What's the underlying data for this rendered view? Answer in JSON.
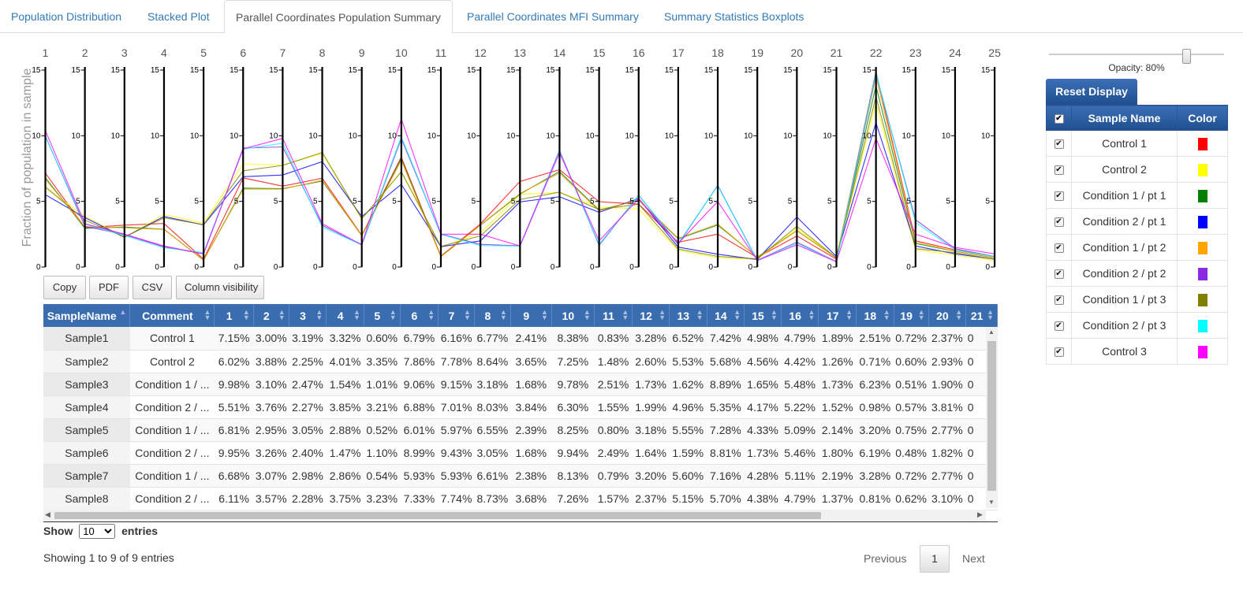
{
  "tabs": [
    {
      "label": "Population Distribution",
      "active": false
    },
    {
      "label": "Stacked Plot",
      "active": false
    },
    {
      "label": "Parallel Coordinates Population Summary",
      "active": true
    },
    {
      "label": "Parallel Coordinates MFI Summary",
      "active": false
    },
    {
      "label": "Summary Statistics Boxplots",
      "active": false
    }
  ],
  "chart_data": {
    "type": "line",
    "ylabel": "Fraction of population in sample",
    "axes": [
      "1",
      "2",
      "3",
      "4",
      "5",
      "6",
      "7",
      "8",
      "9",
      "10",
      "11",
      "12",
      "13",
      "14",
      "15",
      "16",
      "17",
      "18",
      "19",
      "20",
      "21",
      "22",
      "23",
      "24",
      "25"
    ],
    "ylim": [
      0,
      15
    ],
    "yticks": [
      0,
      5,
      10,
      15
    ],
    "series": [
      {
        "name": "Control 1",
        "color": "#ff0000",
        "values": [
          7.15,
          3.0,
          3.19,
          3.32,
          0.6,
          6.79,
          6.16,
          6.77,
          2.41,
          8.38,
          0.83,
          3.28,
          6.52,
          7.42,
          4.98,
          4.79,
          1.89,
          2.51,
          0.72,
          2.37,
          0.6,
          14.9,
          2.0,
          1.3,
          0.8
        ]
      },
      {
        "name": "Control 2",
        "color": "#ffff00",
        "values": [
          6.02,
          3.88,
          2.25,
          4.01,
          3.35,
          7.86,
          7.78,
          8.64,
          3.65,
          7.25,
          1.48,
          2.6,
          5.53,
          5.68,
          4.56,
          4.42,
          1.26,
          0.71,
          0.6,
          2.93,
          0.7,
          12.5,
          1.3,
          0.9,
          0.5
        ]
      },
      {
        "name": "Condition 1 / pt 1",
        "color": "#008000",
        "values": [
          6.81,
          2.95,
          3.05,
          2.88,
          0.52,
          6.01,
          5.97,
          6.55,
          2.39,
          8.25,
          0.8,
          3.18,
          5.55,
          7.28,
          4.33,
          5.09,
          2.14,
          3.2,
          0.75,
          2.77,
          0.7,
          13.8,
          1.8,
          1.2,
          0.7
        ]
      },
      {
        "name": "Condition 2 / pt 1",
        "color": "#0000ff",
        "values": [
          5.51,
          3.76,
          2.27,
          3.85,
          3.21,
          6.88,
          7.01,
          8.03,
          3.84,
          6.3,
          1.55,
          1.99,
          4.96,
          5.35,
          4.17,
          5.22,
          1.52,
          0.98,
          0.57,
          3.81,
          0.8,
          11.0,
          1.6,
          1.0,
          0.6
        ]
      },
      {
        "name": "Condition 1 / pt 2",
        "color": "#ffa500",
        "values": [
          6.68,
          3.07,
          2.98,
          2.86,
          0.54,
          5.93,
          5.93,
          6.61,
          2.38,
          8.13,
          0.79,
          3.2,
          5.6,
          7.16,
          4.28,
          5.11,
          2.19,
          3.28,
          0.72,
          2.77,
          0.7,
          14.5,
          1.9,
          1.2,
          0.7
        ]
      },
      {
        "name": "Condition 2 / pt 2",
        "color": "#8a2be2",
        "values": [
          9.98,
          3.1,
          2.47,
          1.54,
          1.01,
          9.06,
          9.15,
          3.18,
          1.68,
          9.78,
          2.51,
          1.73,
          1.62,
          8.89,
          1.65,
          5.48,
          1.73,
          6.23,
          0.51,
          1.9,
          0.4,
          14.7,
          3.6,
          1.4,
          0.8
        ]
      },
      {
        "name": "Condition 1 / pt 3",
        "color": "#808000",
        "values": [
          6.11,
          3.57,
          2.28,
          3.75,
          3.23,
          7.33,
          7.74,
          8.73,
          3.68,
          7.26,
          1.57,
          2.37,
          5.15,
          5.7,
          4.38,
          4.79,
          1.37,
          0.81,
          0.62,
          3.1,
          0.7,
          13.0,
          1.4,
          1.1,
          0.6
        ]
      },
      {
        "name": "Condition 2 / pt 3",
        "color": "#00ffff",
        "values": [
          9.95,
          3.26,
          2.4,
          1.47,
          1.1,
          8.99,
          9.43,
          3.05,
          1.68,
          9.94,
          2.49,
          1.64,
          1.59,
          8.81,
          1.73,
          5.46,
          1.8,
          6.19,
          0.48,
          1.82,
          0.4,
          14.8,
          3.4,
          1.3,
          0.8
        ]
      },
      {
        "name": "Control 3",
        "color": "#ff00ff",
        "values": [
          10.4,
          3.3,
          2.5,
          1.6,
          1.0,
          9.0,
          9.8,
          3.3,
          1.7,
          11.3,
          2.5,
          2.5,
          1.6,
          8.7,
          2.0,
          5.2,
          1.8,
          5.0,
          0.5,
          1.7,
          0.4,
          9.8,
          2.5,
          1.5,
          1.0
        ]
      }
    ]
  },
  "buttons": {
    "copy": "Copy",
    "pdf": "PDF",
    "csv": "CSV",
    "colvis": "Column visibility"
  },
  "table": {
    "headers": [
      "SampleName",
      "Comment",
      "1",
      "2",
      "3",
      "4",
      "5",
      "6",
      "7",
      "8",
      "9",
      "10",
      "11",
      "12",
      "13",
      "14",
      "15",
      "16",
      "17",
      "18",
      "19",
      "20",
      "21"
    ],
    "rows": [
      [
        "Sample1",
        "Control 1",
        "7.15%",
        "3.00%",
        "3.19%",
        "3.32%",
        "0.60%",
        "6.79%",
        "6.16%",
        "6.77%",
        "2.41%",
        "8.38%",
        "0.83%",
        "3.28%",
        "6.52%",
        "7.42%",
        "4.98%",
        "4.79%",
        "1.89%",
        "2.51%",
        "0.72%",
        "2.37%",
        "0"
      ],
      [
        "Sample2",
        "Control 2",
        "6.02%",
        "3.88%",
        "2.25%",
        "4.01%",
        "3.35%",
        "7.86%",
        "7.78%",
        "8.64%",
        "3.65%",
        "7.25%",
        "1.48%",
        "2.60%",
        "5.53%",
        "5.68%",
        "4.56%",
        "4.42%",
        "1.26%",
        "0.71%",
        "0.60%",
        "2.93%",
        "0"
      ],
      [
        "Sample3",
        "Condition 1 / ...",
        "9.98%",
        "3.10%",
        "2.47%",
        "1.54%",
        "1.01%",
        "9.06%",
        "9.15%",
        "3.18%",
        "1.68%",
        "9.78%",
        "2.51%",
        "1.73%",
        "1.62%",
        "8.89%",
        "1.65%",
        "5.48%",
        "1.73%",
        "6.23%",
        "0.51%",
        "1.90%",
        "0"
      ],
      [
        "Sample4",
        "Condition 2 / ...",
        "5.51%",
        "3.76%",
        "2.27%",
        "3.85%",
        "3.21%",
        "6.88%",
        "7.01%",
        "8.03%",
        "3.84%",
        "6.30%",
        "1.55%",
        "1.99%",
        "4.96%",
        "5.35%",
        "4.17%",
        "5.22%",
        "1.52%",
        "0.98%",
        "0.57%",
        "3.81%",
        "0"
      ],
      [
        "Sample5",
        "Condition 1 / ...",
        "6.81%",
        "2.95%",
        "3.05%",
        "2.88%",
        "0.52%",
        "6.01%",
        "5.97%",
        "6.55%",
        "2.39%",
        "8.25%",
        "0.80%",
        "3.18%",
        "5.55%",
        "7.28%",
        "4.33%",
        "5.09%",
        "2.14%",
        "3.20%",
        "0.75%",
        "2.77%",
        "0"
      ],
      [
        "Sample6",
        "Condition 2 / ...",
        "9.95%",
        "3.26%",
        "2.40%",
        "1.47%",
        "1.10%",
        "8.99%",
        "9.43%",
        "3.05%",
        "1.68%",
        "9.94%",
        "2.49%",
        "1.64%",
        "1.59%",
        "8.81%",
        "1.73%",
        "5.46%",
        "1.80%",
        "6.19%",
        "0.48%",
        "1.82%",
        "0"
      ],
      [
        "Sample7",
        "Condition 1 / ...",
        "6.68%",
        "3.07%",
        "2.98%",
        "2.86%",
        "0.54%",
        "5.93%",
        "5.93%",
        "6.61%",
        "2.38%",
        "8.13%",
        "0.79%",
        "3.20%",
        "5.60%",
        "7.16%",
        "4.28%",
        "5.11%",
        "2.19%",
        "3.28%",
        "0.72%",
        "2.77%",
        "0"
      ],
      [
        "Sample8",
        "Condition 2 / ...",
        "6.11%",
        "3.57%",
        "2.28%",
        "3.75%",
        "3.23%",
        "7.33%",
        "7.74%",
        "8.73%",
        "3.68%",
        "7.26%",
        "1.57%",
        "2.37%",
        "5.15%",
        "5.70%",
        "4.38%",
        "4.79%",
        "1.37%",
        "0.81%",
        "0.62%",
        "3.10%",
        "0"
      ]
    ]
  },
  "length": {
    "show": "Show",
    "value": "10",
    "options": [
      "10"
    ],
    "entries": "entries"
  },
  "info": "Showing 1 to 9 of 9 entries",
  "pager": {
    "previous": "Previous",
    "page": "1",
    "next": "Next"
  },
  "opacity": {
    "label": "Opacity: 80%",
    "value": 0.8
  },
  "reset": "Reset Display",
  "legend": {
    "headers": {
      "name": "Sample Name",
      "color": "Color"
    },
    "items": [
      {
        "name": "Control 1",
        "color": "#ff0000"
      },
      {
        "name": "Control 2",
        "color": "#ffff00"
      },
      {
        "name": "Condition 1 / pt 1",
        "color": "#008000"
      },
      {
        "name": "Condition 2 / pt 1",
        "color": "#0000ff"
      },
      {
        "name": "Condition 1 / pt 2",
        "color": "#ffa500"
      },
      {
        "name": "Condition 2 / pt 2",
        "color": "#8a2be2"
      },
      {
        "name": "Condition 1 / pt 3",
        "color": "#808000"
      },
      {
        "name": "Condition 2 / pt 3",
        "color": "#00ffff"
      },
      {
        "name": "Control 3",
        "color": "#ff00ff"
      }
    ]
  }
}
